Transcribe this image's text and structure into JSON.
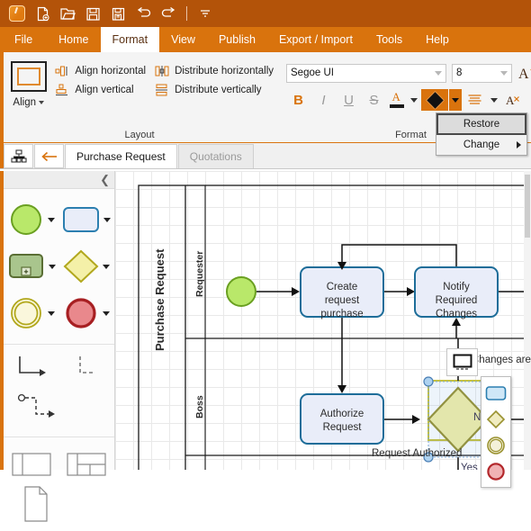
{
  "quick_access": {
    "items": [
      {
        "name": "app-logo",
        "label": "Bizagi"
      },
      {
        "name": "new-document-icon",
        "label": "New"
      },
      {
        "name": "open-icon",
        "label": "Open"
      },
      {
        "name": "save-icon",
        "label": "Save"
      },
      {
        "name": "save-as-icon",
        "label": "Save As"
      },
      {
        "name": "undo-icon",
        "label": "Undo"
      },
      {
        "name": "redo-icon",
        "label": "Redo"
      },
      {
        "name": "customize-quick-access-icon",
        "label": "Customize"
      }
    ]
  },
  "ribbon": {
    "tabs": [
      {
        "label": "File",
        "active": false
      },
      {
        "label": "Home",
        "active": false
      },
      {
        "label": "Format",
        "active": true
      },
      {
        "label": "View",
        "active": false
      },
      {
        "label": "Publish",
        "active": false
      },
      {
        "label": "Export / Import",
        "active": false
      },
      {
        "label": "Tools",
        "active": false
      },
      {
        "label": "Help",
        "active": false
      }
    ],
    "groups": [
      {
        "title": "Layout",
        "align_button": "Align",
        "items": [
          {
            "label": "Align horizontal",
            "icon": "align-horizontal-icon"
          },
          {
            "label": "Align vertical",
            "icon": "align-vertical-icon"
          },
          {
            "label": "Distribute horizontally",
            "icon": "distribute-horizontally-icon"
          },
          {
            "label": "Distribute vertically",
            "icon": "distribute-vertically-icon"
          }
        ]
      },
      {
        "title": "Format",
        "font_family": "Segoe UI",
        "font_size": "8",
        "bold": "B",
        "italic": "I",
        "underline": "U",
        "strikethrough": "S",
        "font_color_icon": "font-color-icon",
        "fill_color_icon": "fill-color-icon",
        "align_text_icon": "text-align-icon",
        "grow_font_icon": "grow-font-icon",
        "shrink_font_icon": "shrink-font-icon"
      }
    ]
  },
  "context_menu": {
    "items": [
      {
        "label": "Restore",
        "highlighted": true,
        "has_submenu": false
      },
      {
        "label": "Change",
        "highlighted": false,
        "has_submenu": true
      }
    ]
  },
  "diagram_tabs": {
    "nav_icon": "diagram-tree-icon",
    "back_icon": "back-arrow-icon",
    "tabs": [
      {
        "label": "Purchase Request",
        "active": true
      },
      {
        "label": "Quotations",
        "active": false
      }
    ]
  },
  "palette": {
    "collapse_icon": "collapse-panel-icon",
    "groups": [
      {
        "shapes": [
          {
            "name": "start-event-shape",
            "fill": "#b9e86a",
            "stroke": "#6aa021"
          },
          {
            "name": "task-shape",
            "fill": "#e9edf9",
            "stroke": "#2c7fb0"
          },
          {
            "name": "subprocess-shape",
            "fill": "#a9c58d",
            "stroke": "#5a6e34"
          },
          {
            "name": "gateway-shape",
            "fill": "#f4f0a8",
            "stroke": "#b2a81e"
          },
          {
            "name": "intermediate-event-shape",
            "fill": "#faf7dc",
            "stroke": "#b2a81e"
          },
          {
            "name": "end-event-shape",
            "fill": "#e9888c",
            "stroke": "#a71f22"
          }
        ]
      },
      {
        "connectors": [
          {
            "name": "sequence-flow-icon"
          },
          {
            "name": "association-flow-icon"
          },
          {
            "name": "message-flow-icon"
          }
        ]
      },
      {
        "containers": [
          {
            "name": "pool-shape-icon"
          },
          {
            "name": "lane-shape-icon"
          },
          {
            "name": "data-object-icon"
          }
        ]
      }
    ]
  },
  "canvas": {
    "pool_label": "Purchase Request",
    "lanes": [
      {
        "label": "Requester"
      },
      {
        "label": "Boss"
      }
    ],
    "nodes": [
      {
        "name": "start-event",
        "type": "start-event",
        "label": ""
      },
      {
        "name": "create-request-purchase-task",
        "type": "task",
        "label": "Create request purchase"
      },
      {
        "name": "notify-required-changes-task",
        "type": "task",
        "label": "Notify Required Changes"
      },
      {
        "name": "authorize-request-task",
        "type": "task",
        "label": "Authorize Request"
      },
      {
        "name": "request-authorized-gateway",
        "type": "gateway",
        "label": "Request Authorized",
        "selected": true
      }
    ],
    "edge_labels": [
      {
        "text": "Changes are required"
      },
      {
        "text": "No"
      },
      {
        "text": "Yes"
      }
    ]
  },
  "shape_picker": {
    "options": [
      {
        "name": "task-shape-option",
        "fill": "#cfe7f7",
        "stroke": "#2c7fb0"
      },
      {
        "name": "gateway-shape-option",
        "fill": "#f0ecc0",
        "stroke": "#b2a81e"
      },
      {
        "name": "intermediate-event-shape-option",
        "fill": "#f4f1d9",
        "stroke": "#9a9230"
      },
      {
        "name": "end-event-shape-option",
        "fill": "#f0b2b4",
        "stroke": "#b3282c"
      }
    ]
  },
  "float_button": {
    "name": "change-shape-button",
    "icon": "change-shape-icon"
  }
}
